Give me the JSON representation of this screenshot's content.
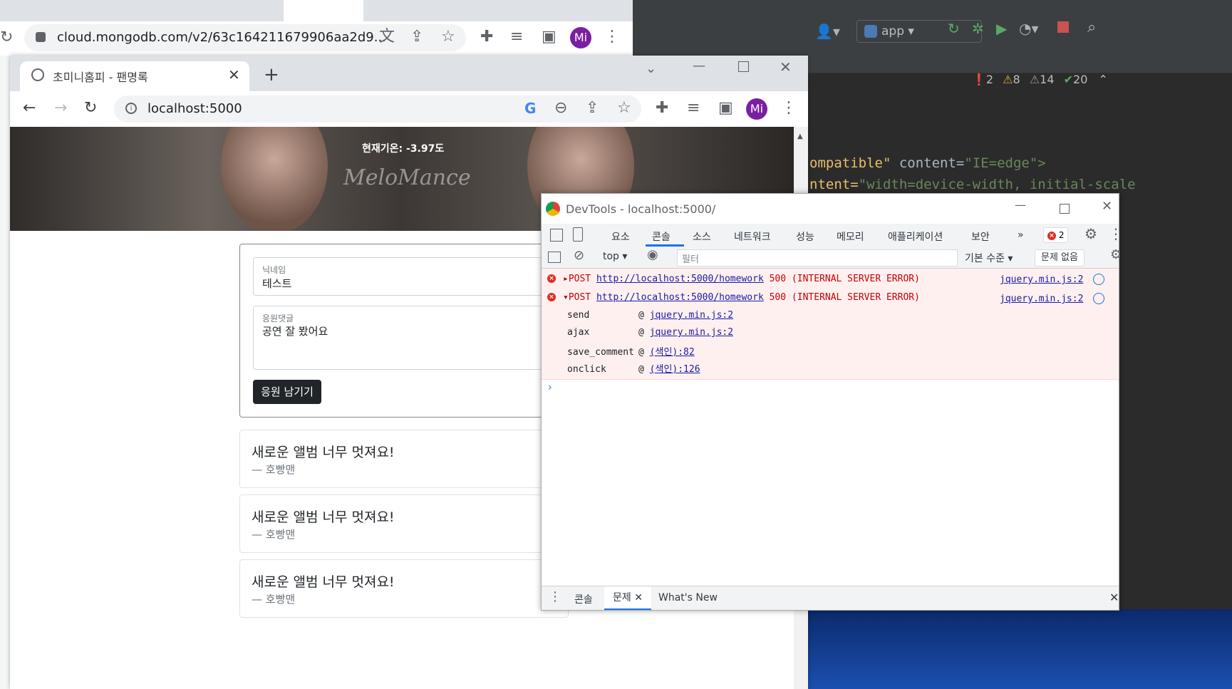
{
  "back_browser": {
    "url": "cloud.mongodb.com/v2/63c164211679906aa2d9...",
    "avatar": "Mi"
  },
  "ide": {
    "run_config": "app",
    "inspections": {
      "errors": "2",
      "warnings": "8",
      "weak_warnings": "14",
      "ok": "20"
    },
    "code_lines": [
      {
        "a": "ompatible\"",
        "b": " content=",
        "c": "\"IE=edge\">"
      },
      {
        "a": "ntent=",
        "b": "\"width=device-width, initial-scale",
        "c": ""
      }
    ]
  },
  "front_browser": {
    "tab_title": "초미니홈피 - 팬명록",
    "url": "localhost:5000",
    "avatar": "Mi"
  },
  "page": {
    "temperature_text": "현재기온: -3.97도",
    "hero_signature": "MeloMance",
    "form": {
      "nickname_label": "닉네임",
      "nickname_value": "테스트",
      "comment_label": "응원댓글",
      "comment_value": "공연 잘 봤어요",
      "submit_label": "응원 남기기"
    },
    "comments": [
      {
        "text": "새로운 앨범 너무 멋져요!",
        "author": "— 호빵맨"
      },
      {
        "text": "새로운 앨범 너무 멋져요!",
        "author": "— 호빵맨"
      },
      {
        "text": "새로운 앨범 너무 멋져요!",
        "author": "— 호빵맨"
      }
    ]
  },
  "devtools": {
    "title": "DevTools - localhost:5000/",
    "tabs": [
      "요소",
      "콘솔",
      "소스",
      "네트워크",
      "성능",
      "메모리",
      "애플리케이션",
      "보안"
    ],
    "active_tab": "콘솔",
    "error_count": "2",
    "context": "top",
    "filter_placeholder": "필터",
    "level": "기본 수준",
    "issues": "문제 없음",
    "errors": [
      {
        "method": "POST",
        "url": "http://localhost:5000/homework",
        "status": "500 (INTERNAL SERVER ERROR)",
        "source": "jquery.min.js:2"
      },
      {
        "method": "POST",
        "url": "http://localhost:5000/homework",
        "status": "500 (INTERNAL SERVER ERROR)",
        "source": "jquery.min.js:2"
      }
    ],
    "stack": [
      {
        "fn": "send",
        "loc": "jquery.min.js:2"
      },
      {
        "fn": "ajax",
        "loc": "jquery.min.js:2"
      },
      {
        "fn": "save_comment",
        "loc": "(색인):82"
      },
      {
        "fn": "onclick",
        "loc": "(색인):126"
      }
    ],
    "drawer_tabs": [
      "콘솔",
      "문제",
      "What's New"
    ]
  }
}
